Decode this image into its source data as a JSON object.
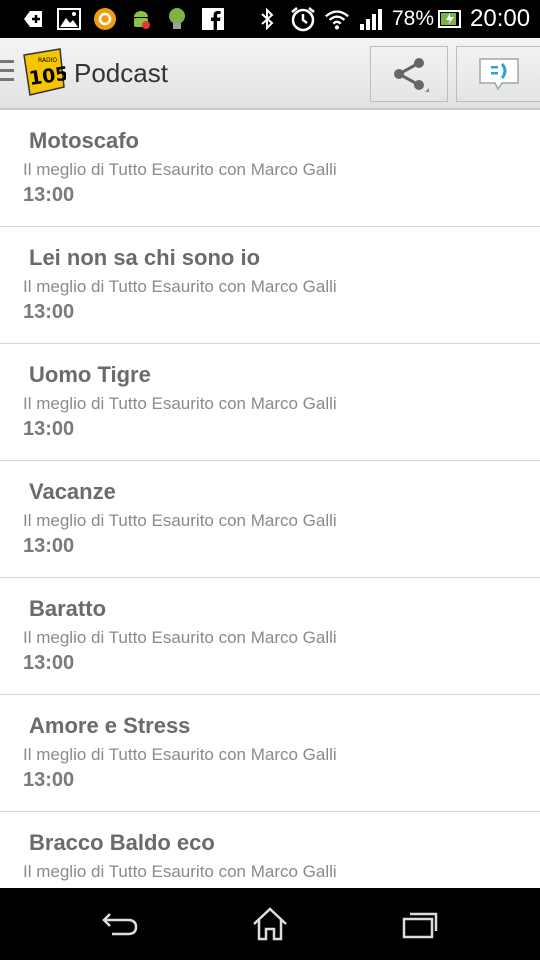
{
  "status_bar": {
    "battery_percent": "78%",
    "time": "20:00",
    "icons": [
      "add-notification-icon",
      "image-icon",
      "orange-app-icon",
      "android-debug-icon",
      "lightbulb-icon",
      "facebook-icon",
      "bluetooth-icon",
      "alarm-icon",
      "wifi-icon",
      "signal-icon",
      "battery-charging-icon"
    ]
  },
  "action_bar": {
    "title": "Podcast",
    "logo": {
      "top_text": "RADIO",
      "number": "105"
    },
    "accent_color": "#f6c400"
  },
  "podcasts": [
    {
      "title": "Motoscafo",
      "subtitle": "Il meglio di Tutto Esaurito con Marco Galli",
      "time": "13:00"
    },
    {
      "title": "Lei non sa chi sono io",
      "subtitle": "Il meglio di Tutto Esaurito con Marco Galli",
      "time": "13:00"
    },
    {
      "title": "Uomo Tigre",
      "subtitle": "Il meglio di Tutto Esaurito con Marco Galli",
      "time": "13:00"
    },
    {
      "title": "Vacanze",
      "subtitle": "Il meglio di Tutto Esaurito con Marco Galli",
      "time": "13:00"
    },
    {
      "title": "Baratto",
      "subtitle": "Il meglio di Tutto Esaurito con Marco Galli",
      "time": "13:00"
    },
    {
      "title": "Amore e Stress",
      "subtitle": "Il meglio di Tutto Esaurito con Marco Galli",
      "time": "13:00"
    },
    {
      "title": "Bracco Baldo eco",
      "subtitle": "Il meglio di Tutto Esaurito con Marco Galli",
      "time": ""
    }
  ],
  "nav_bar": {
    "icons": [
      "back-icon",
      "home-icon",
      "recent-apps-icon"
    ]
  }
}
